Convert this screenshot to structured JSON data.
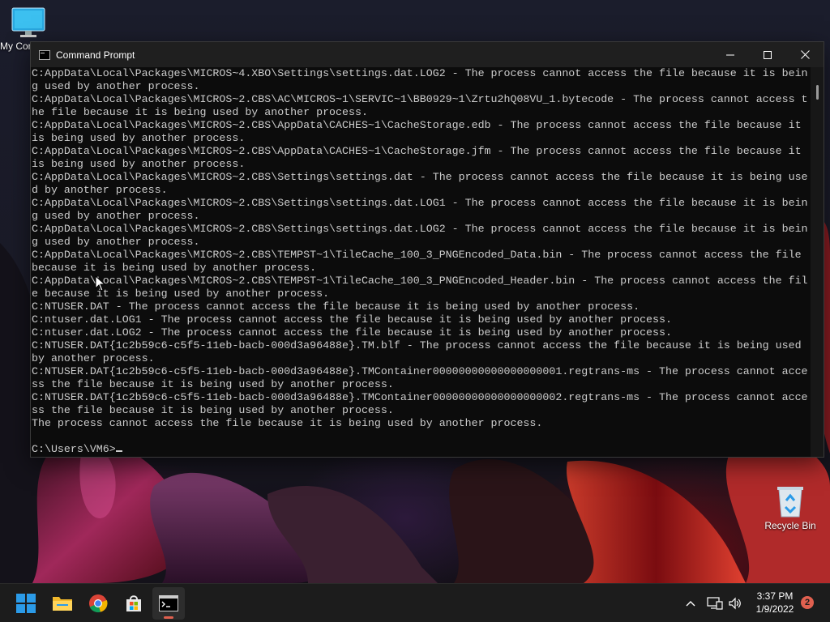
{
  "desktop": {
    "icons": [
      {
        "label": "My Computer"
      },
      {
        "label": "Recycle Bin"
      }
    ]
  },
  "window": {
    "title": "Command Prompt",
    "controls": {
      "minimize": "minimize",
      "maximize": "maximize",
      "close": "close"
    }
  },
  "console": {
    "lines": [
      "C:AppData\\Local\\Packages\\MICROS~4.XBO\\Settings\\settings.dat.LOG2 - The process cannot access the file because it is bein",
      "g used by another process.",
      "C:AppData\\Local\\Packages\\MICROS~2.CBS\\AC\\MICROS~1\\SERVIC~1\\BB0929~1\\Zrtu2hQ08VU_1.bytecode - The process cannot access t",
      "he file because it is being used by another process.",
      "C:AppData\\Local\\Packages\\MICROS~2.CBS\\AppData\\CACHES~1\\CacheStorage.edb - The process cannot access the file because it",
      "is being used by another process.",
      "C:AppData\\Local\\Packages\\MICROS~2.CBS\\AppData\\CACHES~1\\CacheStorage.jfm - The process cannot access the file because it",
      "is being used by another process.",
      "C:AppData\\Local\\Packages\\MICROS~2.CBS\\Settings\\settings.dat - The process cannot access the file because it is being use",
      "d by another process.",
      "C:AppData\\Local\\Packages\\MICROS~2.CBS\\Settings\\settings.dat.LOG1 - The process cannot access the file because it is bein",
      "g used by another process.",
      "C:AppData\\Local\\Packages\\MICROS~2.CBS\\Settings\\settings.dat.LOG2 - The process cannot access the file because it is bein",
      "g used by another process.",
      "C:AppData\\Local\\Packages\\MICROS~2.CBS\\TEMPST~1\\TileCache_100_3_PNGEncoded_Data.bin - The process cannot access the file",
      "because it is being used by another process.",
      "C:AppData\\Local\\Packages\\MICROS~2.CBS\\TEMPST~1\\TileCache_100_3_PNGEncoded_Header.bin - The process cannot access the fil",
      "e because it is being used by another process.",
      "C:NTUSER.DAT - The process cannot access the file because it is being used by another process.",
      "C:ntuser.dat.LOG1 - The process cannot access the file because it is being used by another process.",
      "C:ntuser.dat.LOG2 - The process cannot access the file because it is being used by another process.",
      "C:NTUSER.DAT{1c2b59c6-c5f5-11eb-bacb-000d3a96488e}.TM.blf - The process cannot access the file because it is being used",
      "by another process.",
      "C:NTUSER.DAT{1c2b59c6-c5f5-11eb-bacb-000d3a96488e}.TMContainer00000000000000000001.regtrans-ms - The process cannot acce",
      "ss the file because it is being used by another process.",
      "C:NTUSER.DAT{1c2b59c6-c5f5-11eb-bacb-000d3a96488e}.TMContainer00000000000000000002.regtrans-ms - The process cannot acce",
      "ss the file because it is being used by another process.",
      "The process cannot access the file because it is being used by another process.",
      ""
    ],
    "prompt": "C:\\Users\\VM6>"
  },
  "taskbar": {
    "apps": [
      {
        "name": "Start",
        "icon": "windows-logo-icon"
      },
      {
        "name": "File Explorer",
        "icon": "folder-icon"
      },
      {
        "name": "Google Chrome",
        "icon": "chrome-icon"
      },
      {
        "name": "Microsoft Store",
        "icon": "store-icon"
      },
      {
        "name": "Command Prompt",
        "icon": "terminal-icon",
        "active": true
      }
    ],
    "clock": {
      "time": "3:37 PM",
      "date": "1/9/2022"
    },
    "notifications": "2"
  },
  "colors": {
    "console_bg": "#0c0c0c",
    "console_text": "#cccccc",
    "accent": "#e0604f",
    "windows_blue": "#2b9be8"
  }
}
